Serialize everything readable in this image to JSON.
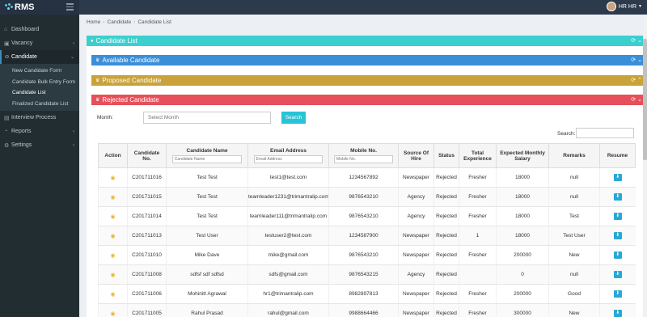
{
  "app": {
    "name": "RMS"
  },
  "user": {
    "name": "HR HR"
  },
  "sidebar": {
    "items": [
      {
        "label": "Dashboard",
        "icon": "home-icon"
      },
      {
        "label": "Vacancy",
        "icon": "briefcase-icon"
      },
      {
        "label": "Candidate",
        "icon": "users-icon",
        "active": true
      },
      {
        "label": "Interview Process",
        "icon": "calendar-icon"
      },
      {
        "label": "Reports",
        "icon": "chart-icon"
      },
      {
        "label": "Settings",
        "icon": "gear-icon"
      }
    ],
    "candidate_sub": [
      "New Candidate Form",
      "Candidate Bulk Entry Form",
      "Candidate List",
      "Finalized Candidate List"
    ]
  },
  "breadcrumb": [
    "Home",
    "Candidate",
    "Candidate List"
  ],
  "panels": {
    "main": "Candidate List",
    "available": "Available Candidate",
    "proposed": "Proposed Candidate",
    "rejected": "Rejected Candidate"
  },
  "filter": {
    "month_label": "Month:",
    "month_placeholder": "Select Month",
    "search_button": "Search",
    "search_label": "Search:"
  },
  "table": {
    "headers": {
      "action": "Action",
      "candidate_no": "Candidate No.",
      "candidate_name": "Candidate Name",
      "email": "Email Address",
      "mobile": "Mobile No.",
      "source": "Source Of Hire",
      "status": "Status",
      "experience": "Total Experience",
      "salary": "Expected Monthly Salary",
      "remarks": "Remarks",
      "resume": "Resume"
    },
    "placeholders": {
      "candidate_name": "Candidate Name",
      "email": "Email Address",
      "mobile": "Mobile No."
    },
    "rows": [
      [
        "C201711016",
        "Test Test",
        "test1@test.com",
        "1234567892",
        "Newspaper",
        "Rejected",
        "Fresher",
        "18000",
        "null"
      ],
      [
        "C201711015",
        "Test Test",
        "teamleader1231@trimantralip.com",
        "9876543210",
        "Agency",
        "Rejected",
        "Fresher",
        "18000",
        "null"
      ],
      [
        "C201711014",
        "Test Test",
        "teamleader111@trimantralip.com",
        "9876543210",
        "Agency",
        "Rejected",
        "Fresher",
        "18000",
        "Test"
      ],
      [
        "C201711013",
        "Test User",
        "testuser2@test.com",
        "1234587900",
        "Newspaper",
        "Rejected",
        "1",
        "18000",
        "Test User"
      ],
      [
        "C201711010",
        "Mike Dave",
        "mike@gmail.com",
        "9876543210",
        "Newspaper",
        "Rejected",
        "Fresher",
        "200000",
        "New"
      ],
      [
        "C201711008",
        "sdfsf sdf sdfsd",
        "sdfs@gmail.com",
        "9876543215",
        "Agency",
        "Rejected",
        "",
        "0",
        "null"
      ],
      [
        "C201711006",
        "Mohinitt Agrawal",
        "hr1@trimantralip.com",
        "8982897813",
        "Newspaper",
        "Rejected",
        "Fresher",
        "200000",
        "Good"
      ],
      [
        "C201711005",
        "Rahul Prasad",
        "rahul@gmail.com",
        "9988664466",
        "Newspaper",
        "Rejected",
        "Fresher",
        "300000",
        "New"
      ]
    ]
  },
  "colors": {
    "main_panel": "#3ccfcf",
    "available_panel": "#3a8fd9",
    "proposed_panel": "#c9a23a",
    "rejected_panel": "#e5505a",
    "sidebar": "#222d32"
  }
}
